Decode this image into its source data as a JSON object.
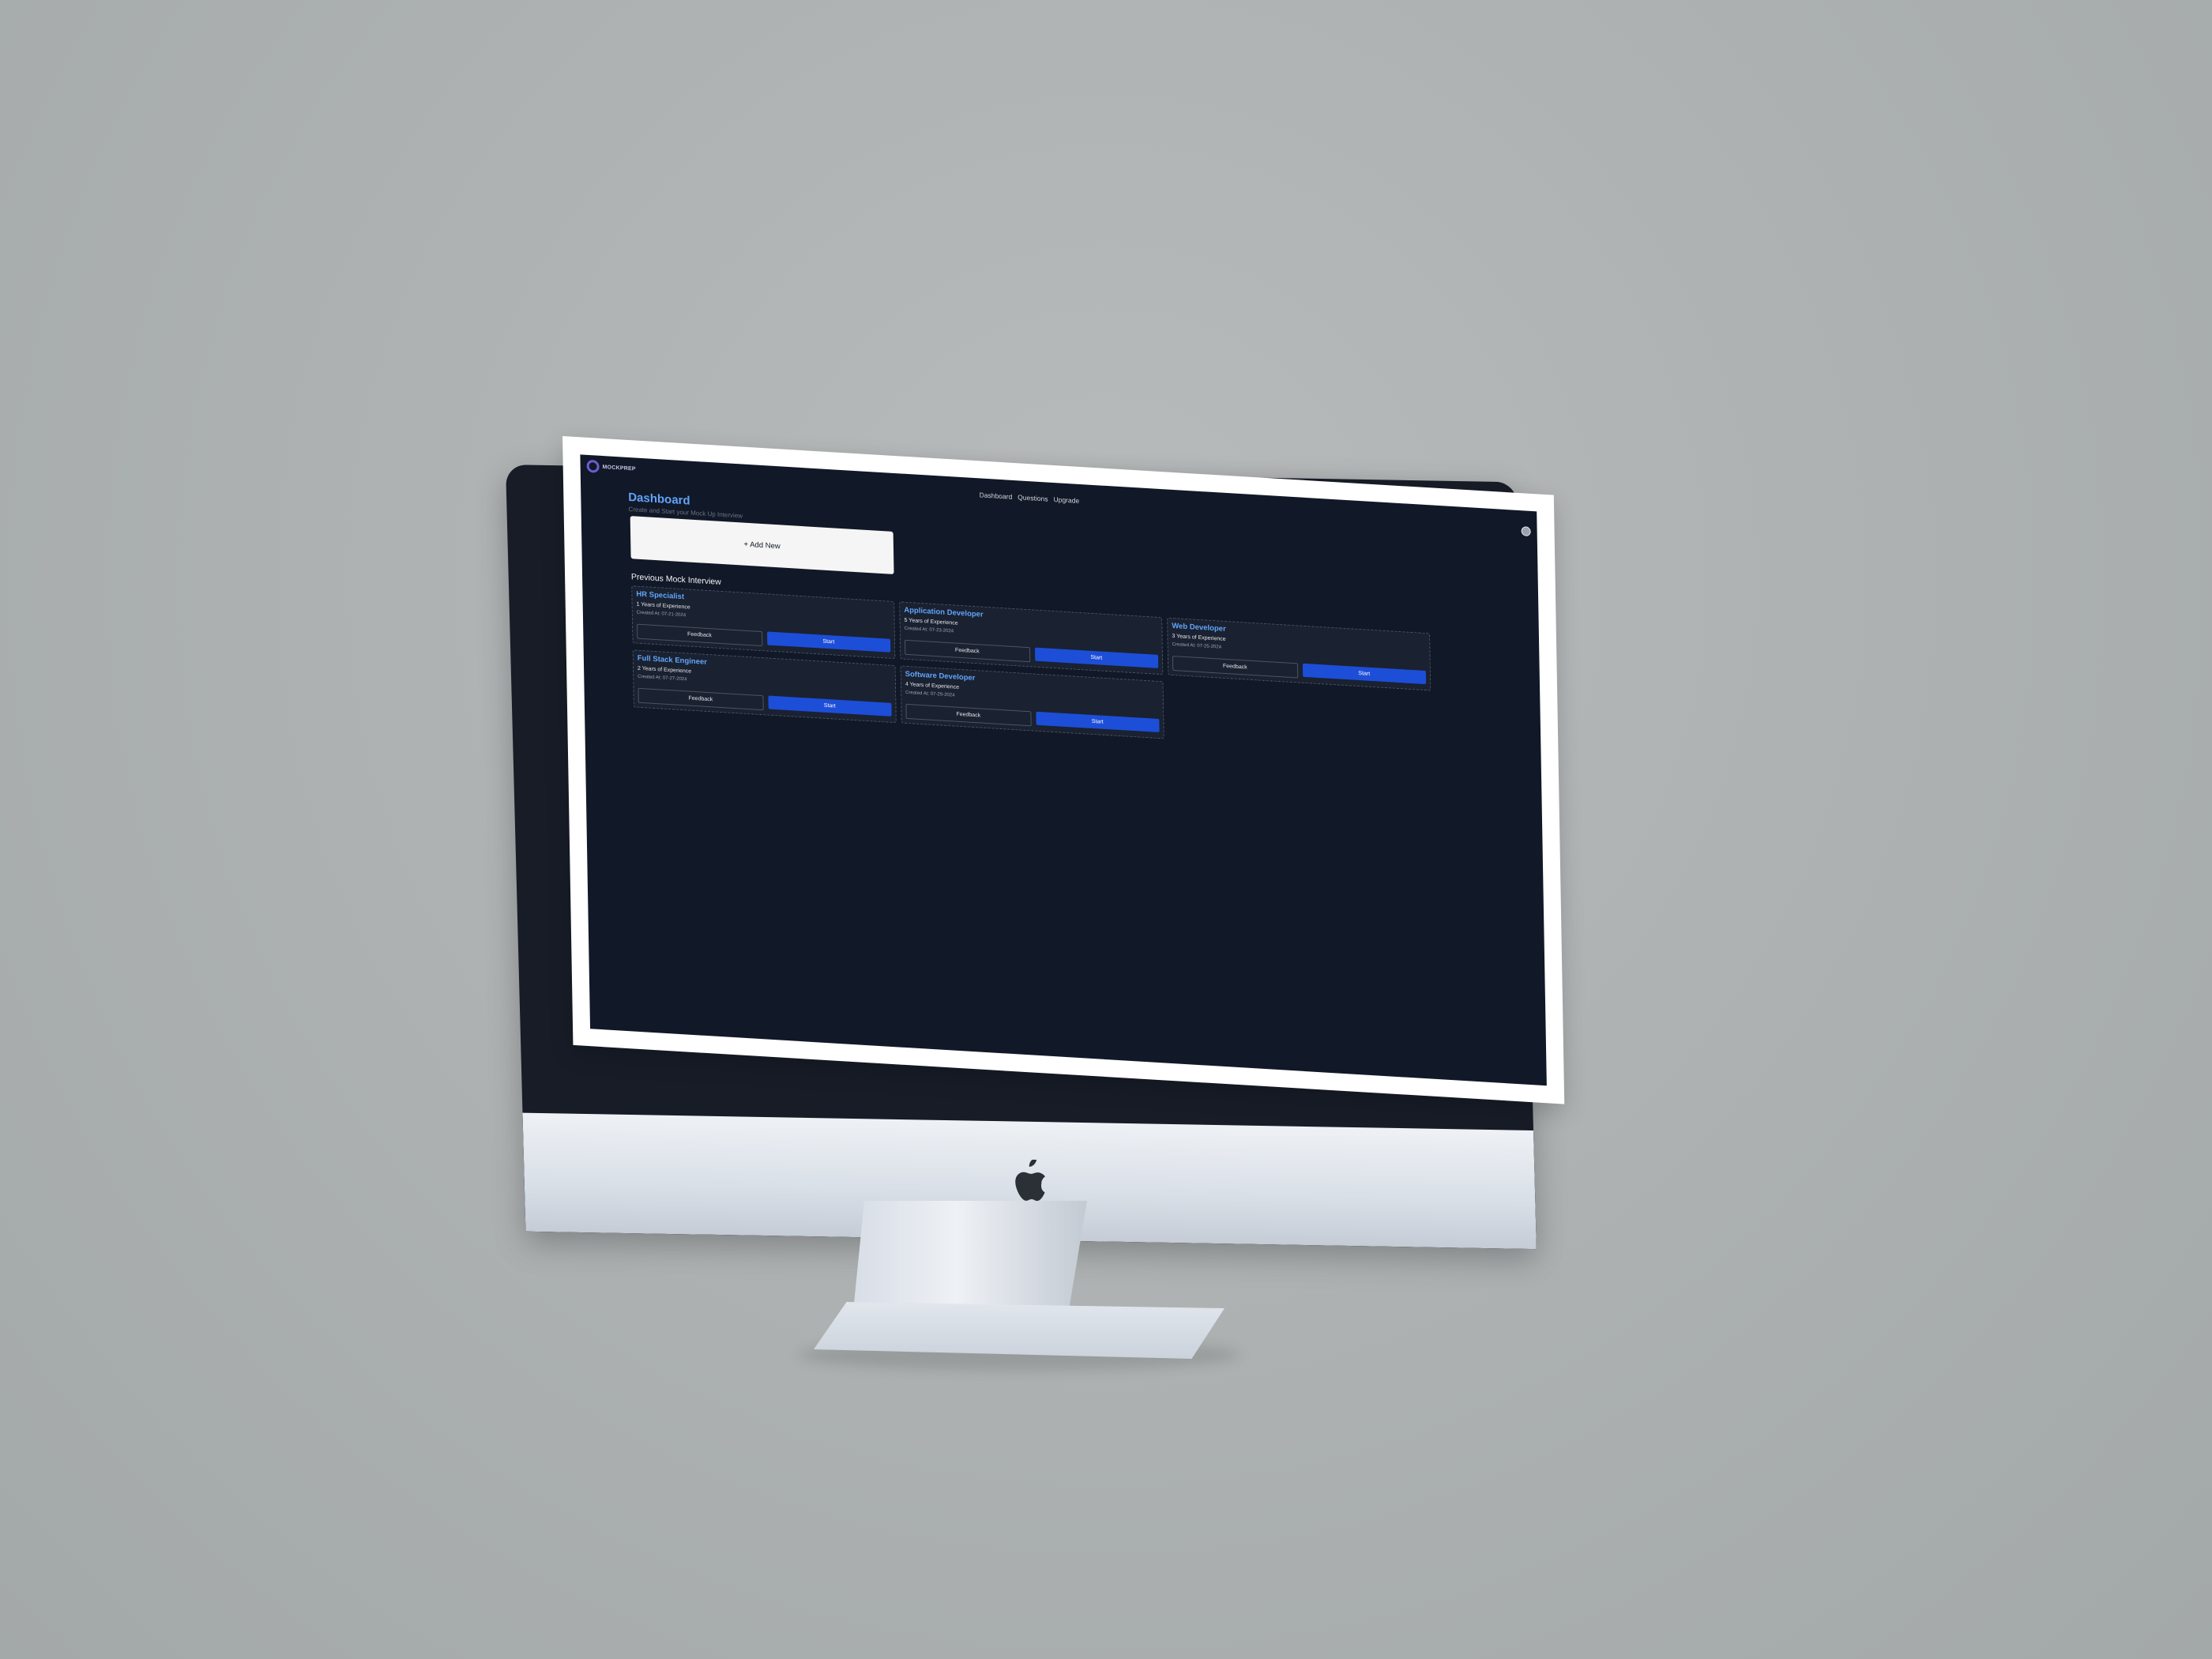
{
  "app": {
    "logo_text": "MOCKPREP",
    "nav": [
      "Dashboard",
      "Questions",
      "Upgrade"
    ]
  },
  "dashboard": {
    "title": "Dashboard",
    "subtitle": "Create and Start your Mock Up Interview",
    "add_new_label": "+ Add New",
    "section_title": "Previous Mock Interview"
  },
  "interviews": [
    {
      "role": "HR Specialist",
      "experience": "1 Years of Experience",
      "created": "Created At: 07-21-2024",
      "feedback_label": "Feedback",
      "start_label": "Start"
    },
    {
      "role": "Application Developer",
      "experience": "5 Years of Experience",
      "created": "Created At: 07-23-2024",
      "feedback_label": "Feedback",
      "start_label": "Start"
    },
    {
      "role": "Web Developer",
      "experience": "3 Years of Experience",
      "created": "Created At: 07-25-2024",
      "feedback_label": "Feedback",
      "start_label": "Start"
    },
    {
      "role": "Full Stack Engineer",
      "experience": "2 Years of Experience",
      "created": "Created At: 07-27-2024",
      "feedback_label": "Feedback",
      "start_label": "Start"
    },
    {
      "role": "Software Developer",
      "experience": "4 Years of Experience",
      "created": "Created At: 07-29-2024",
      "feedback_label": "Feedback",
      "start_label": "Start"
    }
  ],
  "colors": {
    "app_background": "#111827",
    "accent_blue": "#60a5fa",
    "button_blue": "#1d4ed8",
    "card_background": "#1a2130"
  }
}
